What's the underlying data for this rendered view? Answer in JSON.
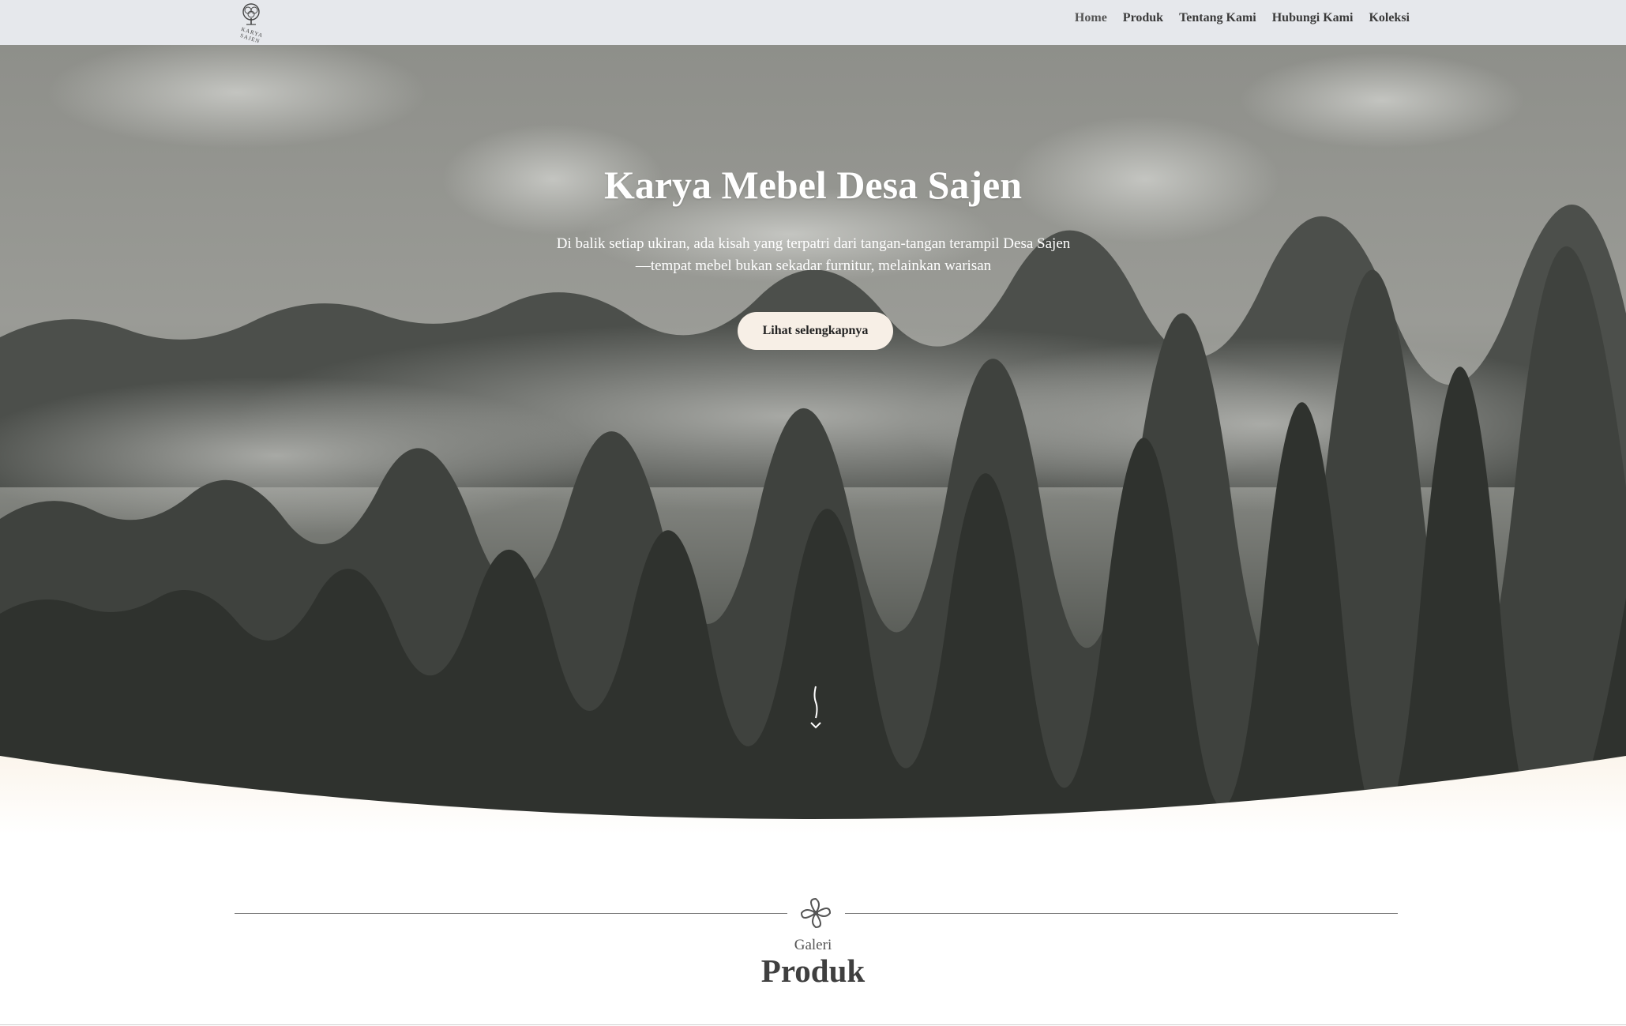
{
  "brand": {
    "logo_text": "KARYA SAJEN",
    "logo_icon": "tree-icon"
  },
  "nav": {
    "items": [
      {
        "label": "Home"
      },
      {
        "label": "Produk"
      },
      {
        "label": "Tentang Kami"
      },
      {
        "label": "Hubungi Kami"
      },
      {
        "label": "Koleksi"
      }
    ]
  },
  "hero": {
    "title": "Karya Mebel Desa Sajen",
    "subtitle": "Di balik setiap ukiran, ada kisah yang terpatri dari tangan-tangan terampil Desa Sajen—tempat mebel bukan sekadar furnitur, melainkan warisan",
    "cta_label": "Lihat selengkapnya",
    "scroll_icon": "scroll-down-icon",
    "background": "misty-forest-photo"
  },
  "section": {
    "kicker": "Galeri",
    "title": "Produk",
    "icon": "flower-ornament-icon"
  },
  "colors": {
    "topbar": "#e6e8ec",
    "cta_bg": "#f7efe6",
    "cream": "#fdf9f3",
    "text_dark": "#3f3f3f"
  }
}
